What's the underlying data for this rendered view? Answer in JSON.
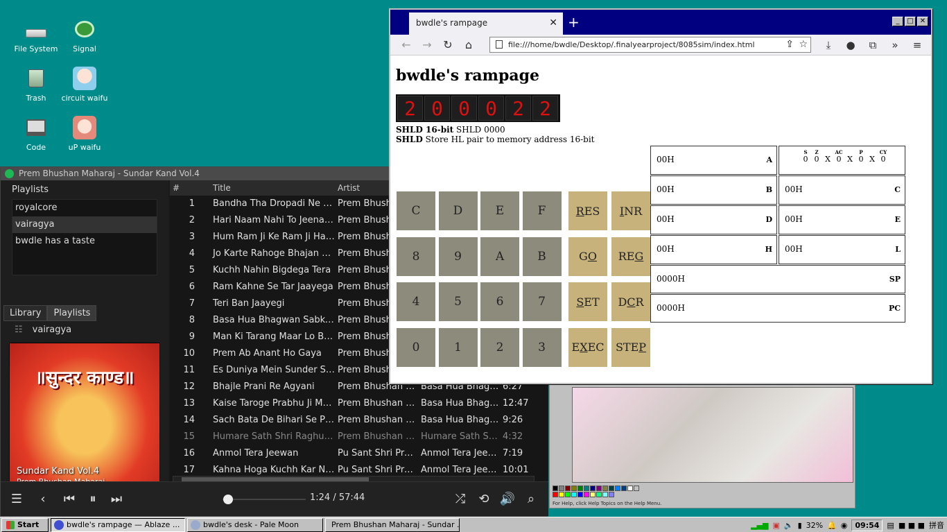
{
  "desktop": {
    "icons": [
      {
        "label": "File System"
      },
      {
        "label": "Signal"
      },
      {
        "label": "Trash"
      },
      {
        "label": "circuit waifu"
      },
      {
        "label": "Code"
      },
      {
        "label": "uP waifu"
      }
    ]
  },
  "player": {
    "window_title": "Prem Bhushan Maharaj - Sundar Kand Vol.4",
    "playlists_heading": "Playlists",
    "playlists": [
      "royalcore",
      "vairagya",
      "bwdle has a taste"
    ],
    "tabs": [
      "Library",
      "Playlists"
    ],
    "current_playlist": "vairagya",
    "cover": {
      "title_text": "॥सुन्दर काण्ड॥",
      "album": "Sundar Kand Vol.4",
      "artist": "Prem Bhushan Maharaj"
    },
    "columns": {
      "num": "#",
      "title": "Title",
      "artist": "Artist"
    },
    "tracks": [
      {
        "num": "1",
        "title": "Bandha Tha Dropadi Ne Tu...",
        "artist": "Prem Bhush",
        "album": "",
        "length": ""
      },
      {
        "num": "2",
        "title": "Hari Naam Nahi To Jeena K...",
        "artist": "Prem Bhush",
        "album": "",
        "length": ""
      },
      {
        "num": "3",
        "title": "Hum Ram Ji Ke Ram Ji Ham...",
        "artist": "Prem Bhush",
        "album": "",
        "length": ""
      },
      {
        "num": "4",
        "title": "Jo Karte Rahoge Bhajan Dh...",
        "artist": "Prem Bhush",
        "album": "",
        "length": ""
      },
      {
        "num": "5",
        "title": "Kuchh Nahin Bigdega Tera",
        "artist": "Prem Bhush",
        "album": "",
        "length": ""
      },
      {
        "num": "6",
        "title": "Ram Kahne Se Tar Jaayega",
        "artist": "Prem Bhush",
        "album": "",
        "length": ""
      },
      {
        "num": "7",
        "title": "Teri Ban Jaayegi",
        "artist": "Prem Bhush",
        "album": "",
        "length": ""
      },
      {
        "num": "8",
        "title": "Basa Hua Bhagwan Sabke ...",
        "artist": "Prem Bhush",
        "album": "",
        "length": ""
      },
      {
        "num": "9",
        "title": "Man Ki Tarang Maar Lo Bas...",
        "artist": "Prem Bhush",
        "album": "",
        "length": ""
      },
      {
        "num": "10",
        "title": "Prem Ab Anant Ho Gaya",
        "artist": "Prem Bhush",
        "album": "",
        "length": ""
      },
      {
        "num": "11",
        "title": "Es Duniya Mein Sunder Su...",
        "artist": "Prem Bhush",
        "album": "",
        "length": ""
      },
      {
        "num": "12",
        "title": "Bhajle Prani Re Agyani",
        "artist": "Prem Bhushan M...",
        "album": "Basa Hua Bhagw...",
        "length": "6:27"
      },
      {
        "num": "13",
        "title": "Kaise Taroge Prabhu Ji Mere",
        "artist": "Prem Bhushan M...",
        "album": "Basa Hua Bhagw...",
        "length": "12:47"
      },
      {
        "num": "14",
        "title": "Sach Bata De Bihari Se Py...",
        "artist": "Prem Bhushan M...",
        "album": "Basa Hua Bhagw...",
        "length": "9:26"
      },
      {
        "num": "15",
        "title": "Humare Sath Shri Raghun...",
        "artist": "Prem Bhushan M...",
        "album": "Humare Sath Sh...",
        "length": "4:32"
      },
      {
        "num": "16",
        "title": "Anmol Tera Jeewan",
        "artist": "Pu Sant Shri Pre...",
        "album": "Anmol Tera Jeevan",
        "length": "7:19"
      },
      {
        "num": "17",
        "title": "Kahna Hoga Kuchh Kar Na ...",
        "artist": "Pu Sant Shri Pre...",
        "album": "Anmol Tera Jeevan",
        "length": "10:01"
      }
    ],
    "time": "1:24 / 57:44",
    "seek_fraction": 0.024
  },
  "browser": {
    "tab_title": "bwdle's rampage",
    "url": "file:///home/bwdle/Desktop/.finalyearproject/8085sim/index.html",
    "page_title": "bwdle's rampage",
    "display_digits": [
      "2",
      "0",
      "0",
      "0",
      "2",
      "2"
    ],
    "desc1_bold": "SHLD 16-bit",
    "desc1_text": " SHLD 0000",
    "desc2_bold": "SHLD",
    "desc2_text": " Store HL pair to memory address 16-bit",
    "keys": [
      "C",
      "D",
      "E",
      "F",
      "8",
      "9",
      "A",
      "B",
      "4",
      "5",
      "6",
      "7",
      "0",
      "1",
      "2",
      "3"
    ],
    "fkeys": [
      {
        "pre": "",
        "u": "R",
        "post": "ES"
      },
      {
        "pre": "",
        "u": "I",
        "post": "NR"
      },
      {
        "pre": "G",
        "u": "O",
        "post": ""
      },
      {
        "pre": "RE",
        "u": "G",
        "post": ""
      },
      {
        "pre": "",
        "u": "S",
        "post": "ET"
      },
      {
        "pre": "D",
        "u": "C",
        "post": "R"
      },
      {
        "pre": "E",
        "u": "X",
        "post": "EC"
      },
      {
        "pre": "STE",
        "u": "P",
        "post": ""
      }
    ],
    "registers": {
      "A": {
        "value": "00H",
        "name": "A"
      },
      "B": {
        "value": "00H",
        "name": "B"
      },
      "C": {
        "value": "00H",
        "name": "C"
      },
      "D": {
        "value": "00H",
        "name": "D"
      },
      "E": {
        "value": "00H",
        "name": "E"
      },
      "H": {
        "value": "00H",
        "name": "H"
      },
      "L": {
        "value": "00H",
        "name": "L"
      },
      "SP": {
        "value": "0000H",
        "name": "SP"
      },
      "PC": {
        "value": "0000H",
        "name": "PC"
      }
    },
    "flags": {
      "labels": [
        "S",
        "Z",
        "",
        "AC",
        "",
        "P",
        "",
        "CY"
      ],
      "values": [
        "0",
        "0",
        "X",
        "0",
        "X",
        "0",
        "X",
        "0"
      ]
    }
  },
  "paint": {
    "status": "For Help, click Help Topics on the Help Menu."
  },
  "taskbar": {
    "start": "Start",
    "tasks": [
      "bwdle's rampage — Ablaze ...",
      "bwdle's desk - Pale Moon",
      "Prem Bhushan Maharaj - Sundar ..."
    ],
    "battery": "32%",
    "clock": "09:54",
    "ime": "■ ■ ■",
    "ime_text": "拼音"
  }
}
